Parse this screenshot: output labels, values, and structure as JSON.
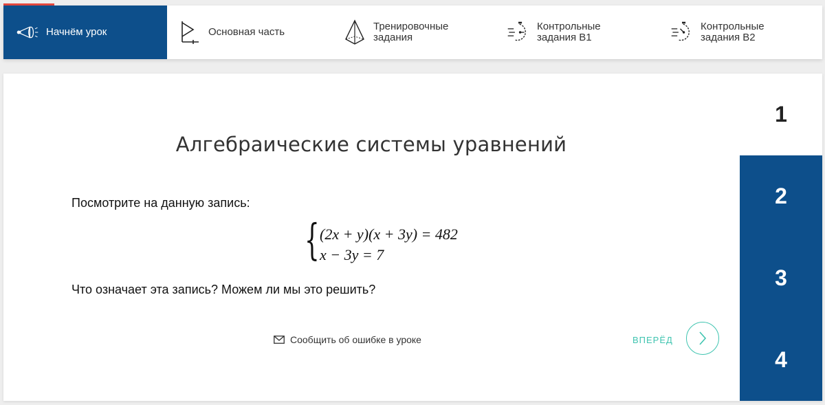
{
  "nav": {
    "tabs": [
      {
        "label": "Начнём урок",
        "icon": "megaphone-icon",
        "active": true
      },
      {
        "label": "Основная часть",
        "icon": "play-icon",
        "active": false
      },
      {
        "label": "Тренировочные\nзадания",
        "icon": "pyramid-icon",
        "active": false
      },
      {
        "label": "Контрольные\nзадания B1",
        "icon": "stopwatch-icon",
        "active": false
      },
      {
        "label": "Контрольные\nзадания B2",
        "icon": "stopwatch-icon",
        "active": false
      }
    ]
  },
  "lesson": {
    "title": "Алгебраические системы уравнений",
    "prompt": "Посмотрите на данную запись:",
    "system": {
      "eq1": "(2x + y)(x + 3y) = 482",
      "eq2": "x − 3y = 7"
    },
    "question": "Что означает эта запись? Можем ли мы это решить?"
  },
  "footer": {
    "report_label": "Сообщить об ошибке в уроке",
    "next_label": "ВПЕРЁД"
  },
  "steps": [
    "1",
    "2",
    "3",
    "4"
  ],
  "colors": {
    "primary": "#0d4f8b",
    "accent": "#3fc4b0",
    "active_marker": "#e3473d"
  }
}
